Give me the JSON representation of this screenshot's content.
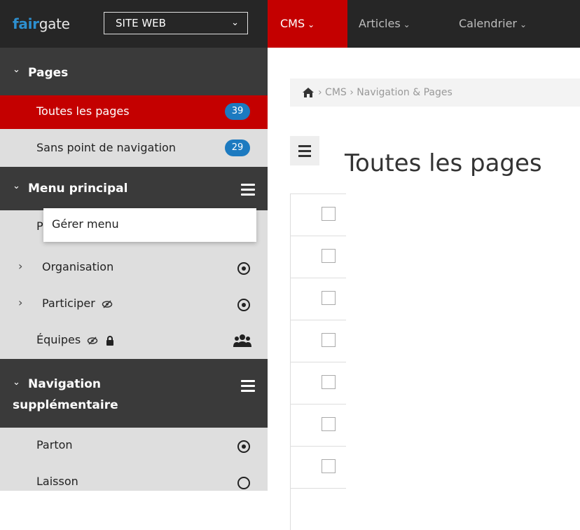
{
  "header": {
    "logo_part1": "fair",
    "logo_part2": "gate",
    "site_selector": "SITE WEB",
    "nav": [
      {
        "label": "CMS"
      },
      {
        "label": "Articles"
      },
      {
        "label": "Calendrier"
      }
    ]
  },
  "sidebar": {
    "pages": {
      "title": "Pages",
      "items": [
        {
          "label": "Toutes les pages",
          "count": "39"
        },
        {
          "label": "Sans point de navigation",
          "count": "29"
        }
      ]
    },
    "menu_principal": {
      "title": "Menu principal",
      "items": [
        {
          "label": "P"
        },
        {
          "label": "Organisation"
        },
        {
          "label": "Participer"
        },
        {
          "label": "Équipes"
        }
      ],
      "dropdown_option": "Gérer menu"
    },
    "nav_supp": {
      "title_line1": "Navigation",
      "title_line2": "supplémentaire",
      "items": [
        {
          "label": "Parton"
        },
        {
          "label": "Laisson"
        }
      ]
    }
  },
  "main": {
    "breadcrumb": "› CMS › Navigation & Pages",
    "title": "Toutes les pages"
  },
  "colors": {
    "accent": "#c40000",
    "badge": "#1c7ac0",
    "topbar": "#262626"
  }
}
